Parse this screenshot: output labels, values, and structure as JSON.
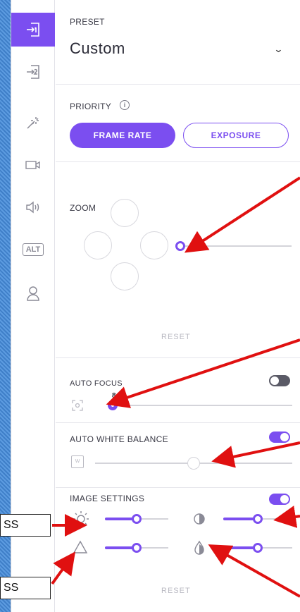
{
  "rail": {
    "items": [
      {
        "icon": "input-1-icon",
        "active": true
      },
      {
        "icon": "input-2-icon",
        "active": false
      },
      {
        "icon": "magic-wand-icon",
        "active": false
      },
      {
        "icon": "camera-icon",
        "active": false
      },
      {
        "icon": "speaker-icon",
        "active": false
      },
      {
        "icon": "alt-icon",
        "label": "ALT",
        "active": false
      },
      {
        "icon": "user-icon",
        "active": false
      }
    ]
  },
  "preset": {
    "label": "PRESET",
    "value": "Custom"
  },
  "priority": {
    "label": "PRIORITY",
    "options": [
      "FRAME RATE",
      "EXPOSURE"
    ],
    "selected": "FRAME RATE"
  },
  "zoom": {
    "label": "ZOOM",
    "value": 0.0,
    "reset_label": "RESET"
  },
  "auto_focus": {
    "label": "AUTO FOCUS",
    "enabled": false,
    "value": "8",
    "value_fraction": 0.0
  },
  "auto_white_balance": {
    "label": "AUTO WHITE BALANCE",
    "enabled": true,
    "value_fraction": 0.5
  },
  "image_settings": {
    "label": "IMAGE SETTINGS",
    "enabled": true,
    "reset_label": "RESET",
    "sliders": [
      {
        "name": "brightness",
        "icon": "sun-icon",
        "value_fraction": 0.5
      },
      {
        "name": "contrast",
        "icon": "contrast-icon",
        "value_fraction": 0.5
      },
      {
        "name": "sharpness",
        "icon": "triangle-icon",
        "value_fraction": 0.5
      },
      {
        "name": "saturation",
        "icon": "drop-icon",
        "value_fraction": 0.5
      }
    ]
  },
  "callouts": [
    {
      "text": "SS"
    },
    {
      "text": "SS"
    }
  ],
  "colors": {
    "accent": "#7b4ef0",
    "arrow": "#e01010",
    "background": "#4f8fd6"
  }
}
